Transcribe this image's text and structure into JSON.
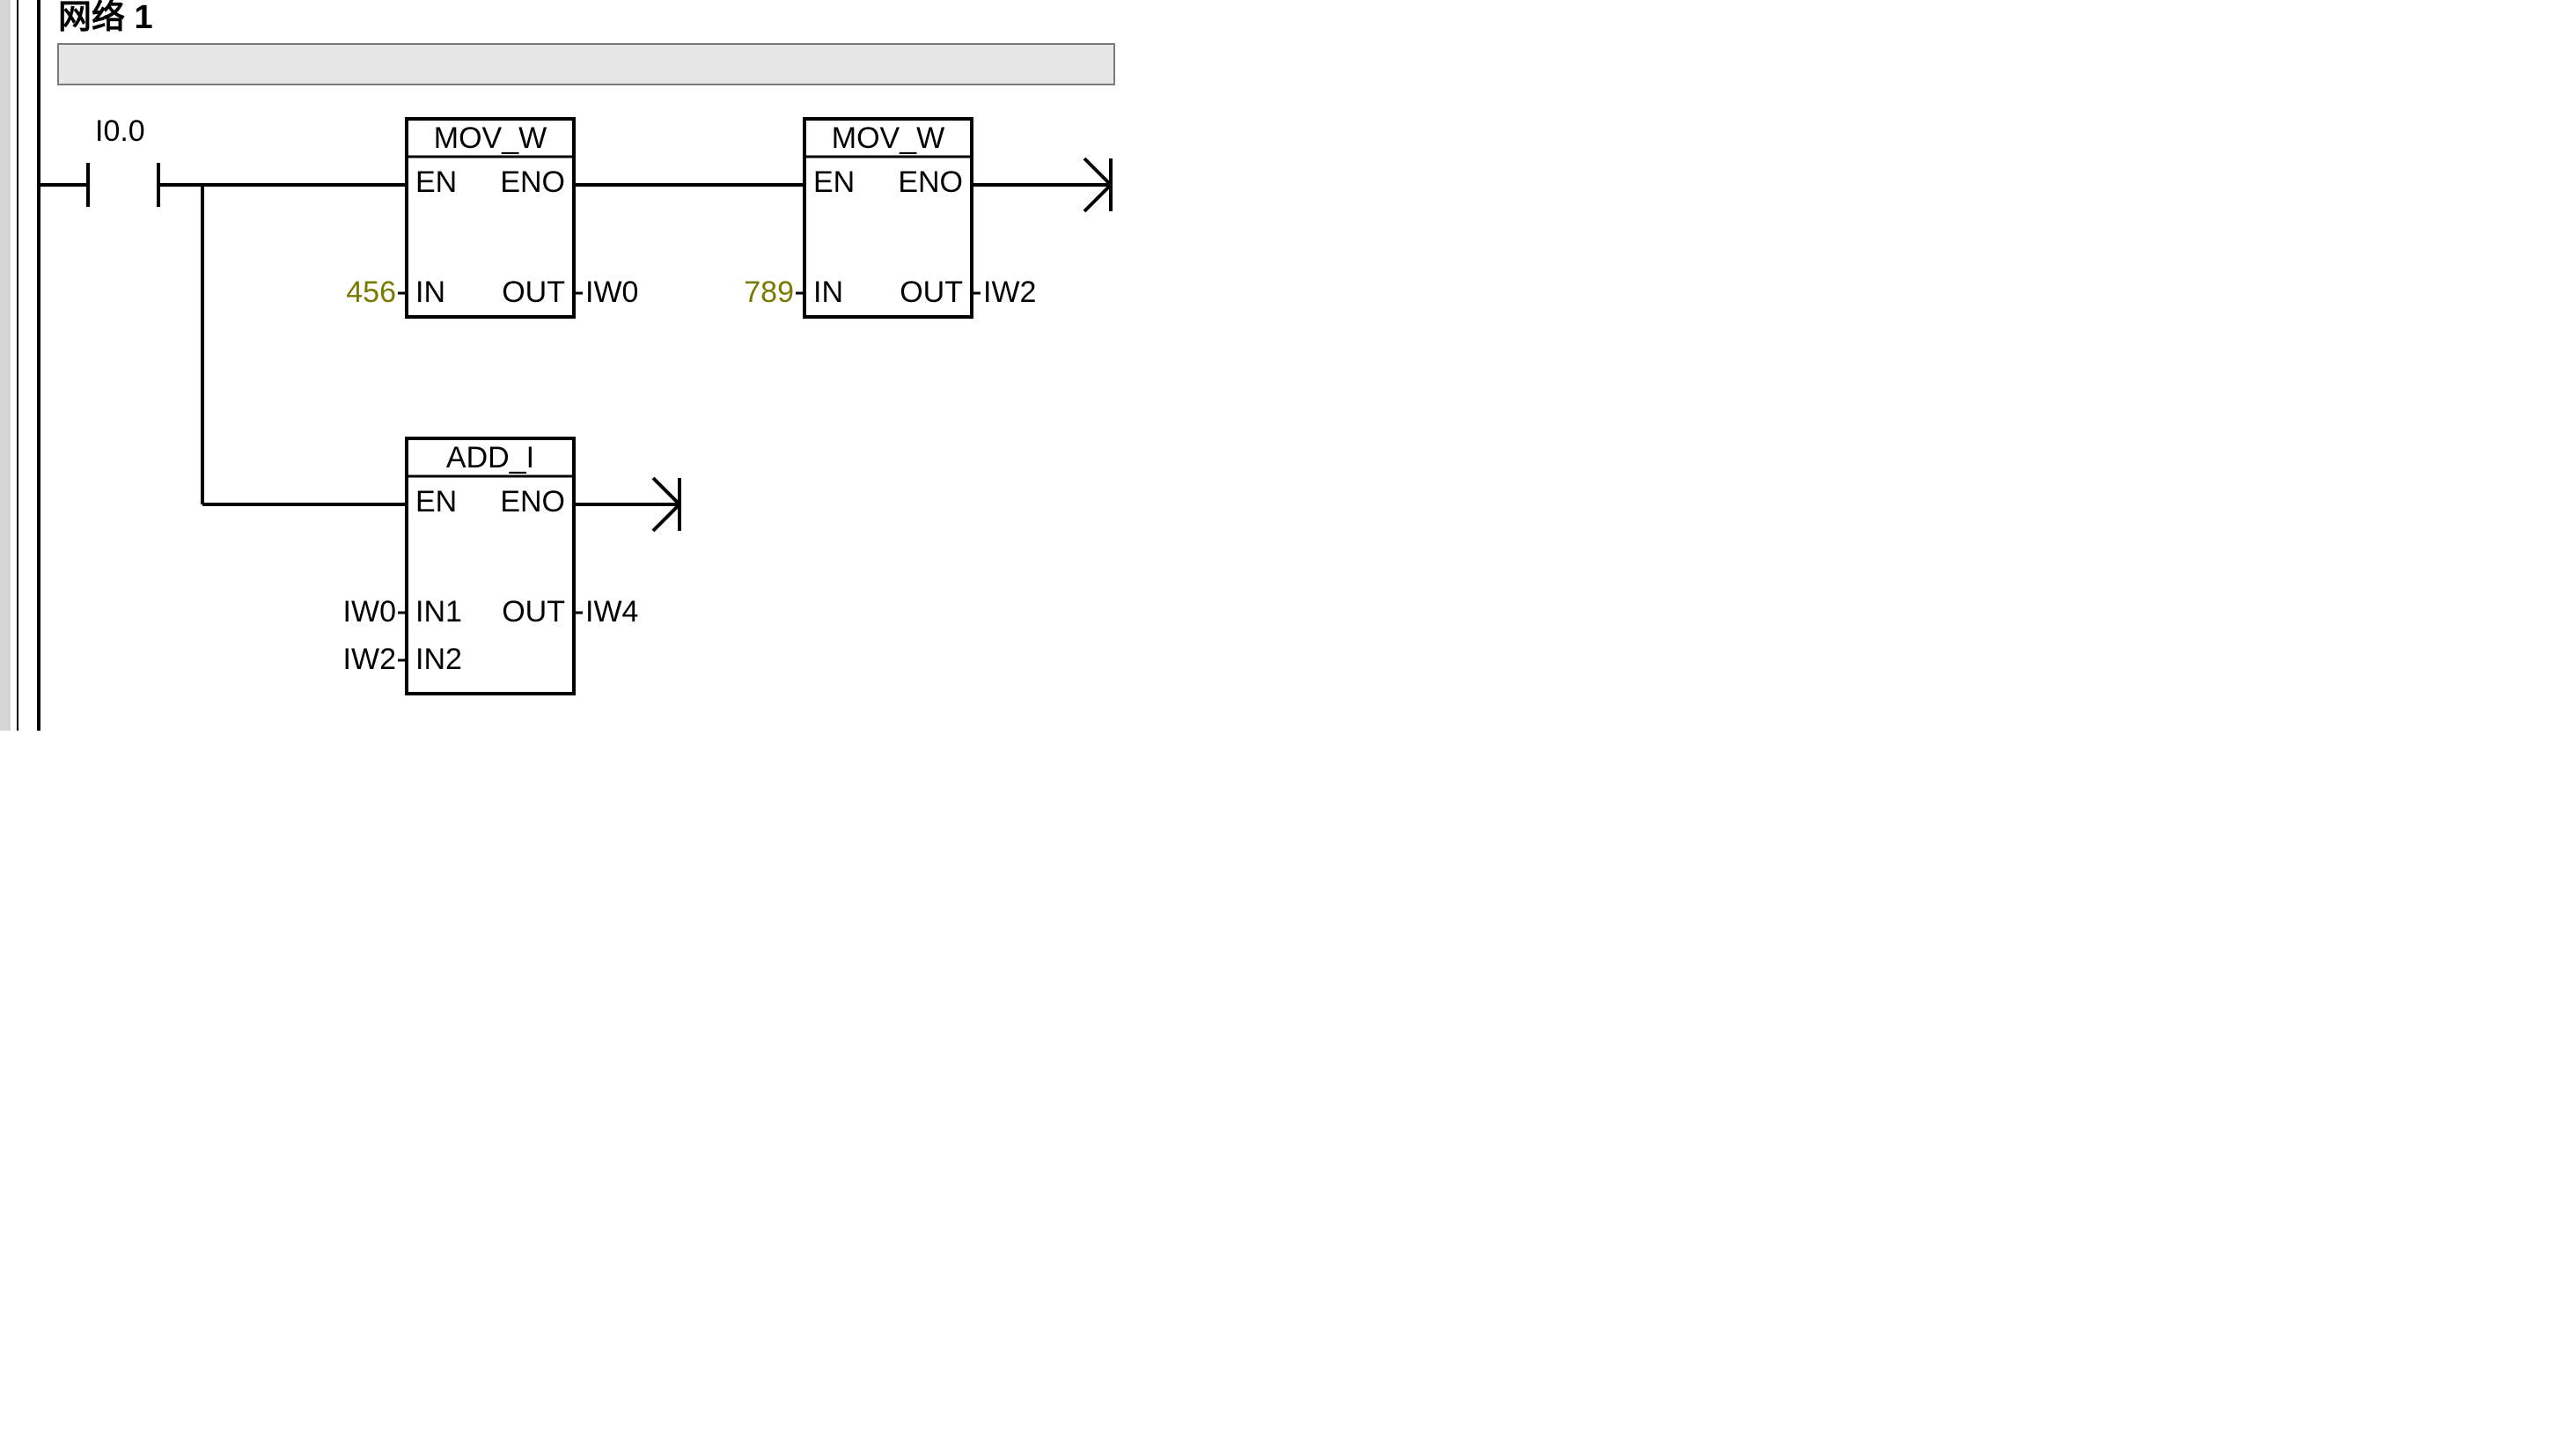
{
  "network": {
    "title": "网络 1"
  },
  "contact": {
    "address": "I0.0"
  },
  "blocks": {
    "mov1": {
      "type": "MOV_W",
      "ports": {
        "en": "EN",
        "eno": "ENO",
        "in": "IN",
        "out": "OUT"
      },
      "in_value": "456",
      "out_value": "IW0"
    },
    "mov2": {
      "type": "MOV_W",
      "ports": {
        "en": "EN",
        "eno": "ENO",
        "in": "IN",
        "out": "OUT"
      },
      "in_value": "789",
      "out_value": "IW2"
    },
    "add": {
      "type": "ADD_I",
      "ports": {
        "en": "EN",
        "eno": "ENO",
        "in1": "IN1",
        "in2": "IN2",
        "out": "OUT"
      },
      "in1_value": "IW0",
      "in2_value": "IW2",
      "out_value": "IW4"
    }
  }
}
